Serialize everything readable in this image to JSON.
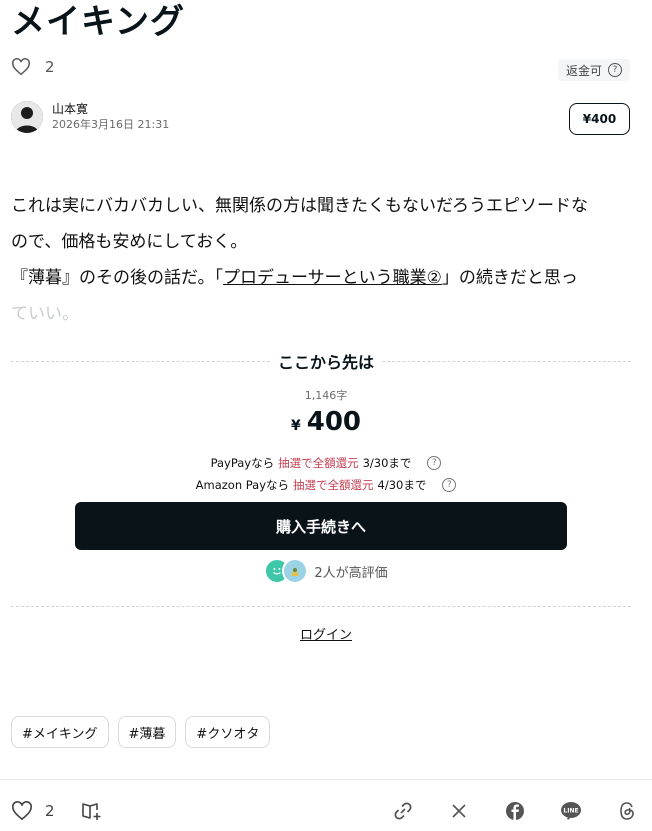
{
  "article": {
    "title": "メイキング",
    "like_count": "2",
    "refund_label": "返金可",
    "author_name": "山本寛",
    "published": "2026年3月16日 21:31",
    "price_button": "¥400",
    "body_line1": "これは実にバカバカしい、無関係の方は聞きたくもないだろうエピソードな",
    "body_line2": "ので、価格も安めにしておく。",
    "body_line3_pre": "『薄暮』のその後の話だ。「",
    "body_link": "プロデューサーという職業②",
    "body_line3_post": "」の続きだと思っ",
    "body_line4": "ていい。"
  },
  "paywall": {
    "heading": "ここから先は",
    "char_count": "1,146字",
    "yen_symbol": "¥",
    "price": "400",
    "promo1_pre": "PayPayなら",
    "promo1_red": "抽選で全額還元",
    "promo1_post": " 3/30まで",
    "promo2_pre": "Amazon Payなら",
    "promo2_red": "抽選で全額還元",
    "promo2_post": " 4/30まで",
    "buy_label": "購入手続きへ",
    "rating_text": "2人が高評価",
    "login_label": "ログイン"
  },
  "tags": [
    "#メイキング",
    "#薄暮",
    "#クソオタ"
  ],
  "footer": {
    "like_count": "2"
  },
  "colors": {
    "buy_button": "#0a1318",
    "promo_red": "#c43f52",
    "rating_avatar_1": "#3ec7a8"
  }
}
